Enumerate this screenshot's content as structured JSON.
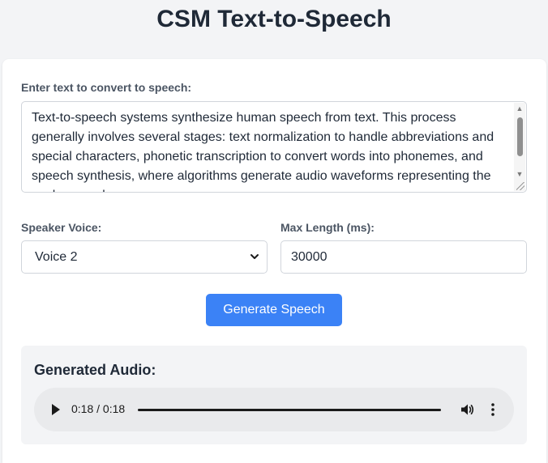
{
  "page": {
    "title": "CSM Text-to-Speech"
  },
  "form": {
    "text_label": "Enter text to convert to speech:",
    "text_value": "Text-to-speech systems synthesize human speech from text. This process generally involves several stages: text normalization to handle abbreviations and special characters, phonetic transcription to convert words into phonemes, and speech synthesis, where algorithms generate audio waveforms representing the spoken words.",
    "speaker_label": "Speaker Voice:",
    "speaker_value": "Voice 2",
    "max_length_label": "Max Length (ms):",
    "max_length_value": "30000",
    "generate_button": "Generate Speech"
  },
  "audio": {
    "heading": "Generated Audio:",
    "time": "0:18 / 0:18",
    "progress": 1.0
  },
  "colors": {
    "accent": "#3b82f6",
    "page_background": "#f3f4f6",
    "card_background": "#ffffff",
    "audio_panel": "#f3f4f6"
  },
  "icons": {
    "play": "play-icon",
    "volume": "volume-icon",
    "more": "more-vertical-icon",
    "dropdown": "chevron-down-icon"
  }
}
